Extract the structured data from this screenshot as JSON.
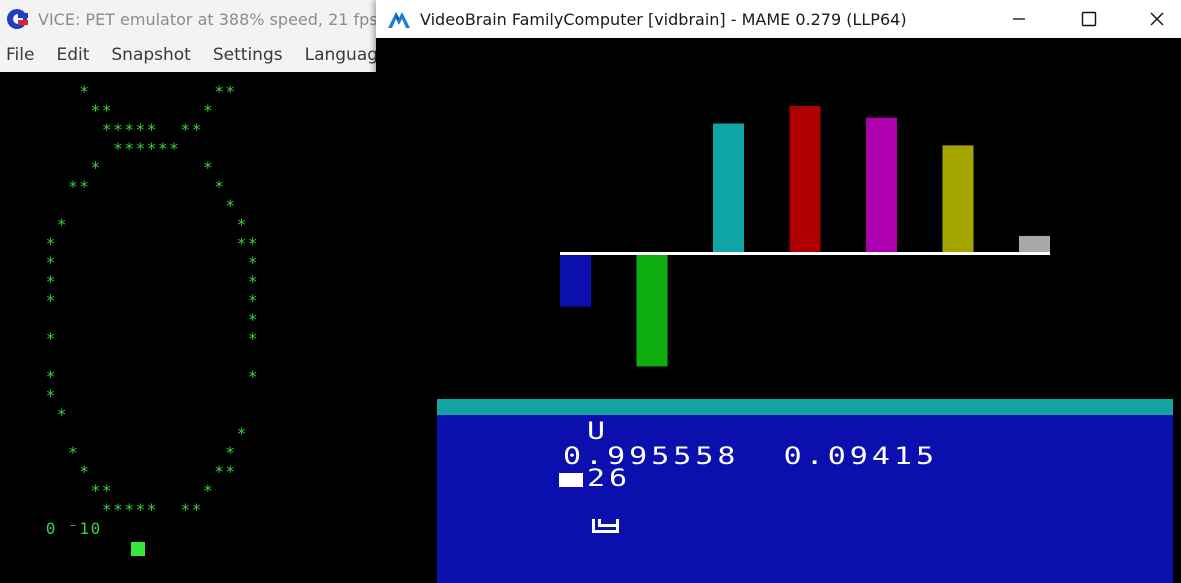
{
  "vice": {
    "title": "VICE: PET emulator at 388% speed, 21 fps",
    "menu": [
      "File",
      "Edit",
      "Snapshot",
      "Settings",
      "Language"
    ],
    "screen_rows": [
      "      *           **",
      "       **        *",
      "        *****  **",
      "         ******",
      "       *         *",
      "     **           *",
      "                   *",
      "    *               *",
      "   *                **",
      "   *                 *",
      "   *                 *",
      "   *                 *",
      "                     *",
      "   *                 *",
      "",
      "   *                 *",
      "   *",
      "    *",
      "                    *",
      "     *             *",
      "      *           **",
      "       **        *",
      "        *****  **",
      "   0 ⁻10"
    ],
    "colors": {
      "text": "#38d238",
      "background": "#000000"
    }
  },
  "mame": {
    "title": "VideoBrain FamilyComputer [vidbrain] - MAME 0.279 (LLP64)",
    "window_buttons": [
      "minimize-icon",
      "maximize-icon",
      "close-icon"
    ],
    "screen": {
      "label": "U",
      "values_line": "0.995558  0.09415",
      "input_line": "26",
      "prompt_symbol": "L"
    },
    "bars": [
      {
        "color": "#0a0fae",
        "value": -0.36
      },
      {
        "color": "#0fae0f",
        "value": -0.77
      },
      {
        "color": "#0fa5a5",
        "value": 0.88
      },
      {
        "color": "#ae0000",
        "value": 1.0
      },
      {
        "color": "#ae00ae",
        "value": 0.92
      },
      {
        "color": "#a5a500",
        "value": 0.73
      },
      {
        "color": "#a8a8a8",
        "value": 0.11
      }
    ],
    "colors": {
      "panel": "#0a0fae",
      "panel_bar": "#14a3a3",
      "axis": "#ffffff"
    }
  }
}
